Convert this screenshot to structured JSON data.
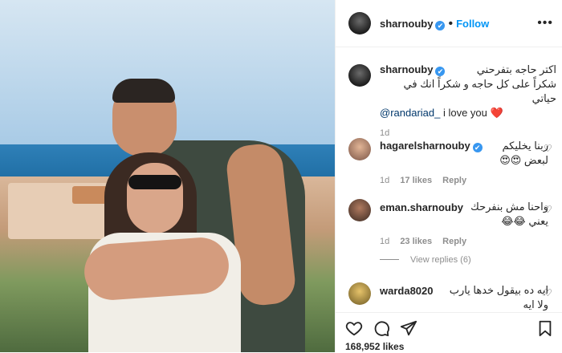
{
  "post": {
    "photo": {
      "description_icon": "photo"
    },
    "author": {
      "username": "sharnouby",
      "verified_icon": "✔",
      "follow_label": "Follow",
      "dot": "•"
    },
    "caption": {
      "username": "sharnouby",
      "line1": "اكتر حاجه بتفرحني",
      "line2": "شكراً على كل حاجه و شكراً انك في حياتي",
      "mention": "@randariad_",
      "tail": " i love you ",
      "heart": "❤️",
      "time": "1d"
    },
    "comments": [
      {
        "username": "hagarelsharnouby",
        "verified_icon": "✔",
        "line1": "ربنا يخليكم",
        "line2": "لبعض 😍😍",
        "time": "1d",
        "likes": "17 likes",
        "reply": "Reply"
      },
      {
        "username": "eman.sharnouby",
        "line1": "واحنا مش بنفرحك",
        "line2": "يعني 😂😂",
        "time": "1d",
        "likes": "23 likes",
        "reply": "Reply",
        "view_replies": "View replies (6)"
      },
      {
        "username": "warda8020",
        "line1": "ايه ده بيقول خدها يارب",
        "line2": "ولا ايه"
      }
    ],
    "likes_count": "168,952 likes"
  }
}
